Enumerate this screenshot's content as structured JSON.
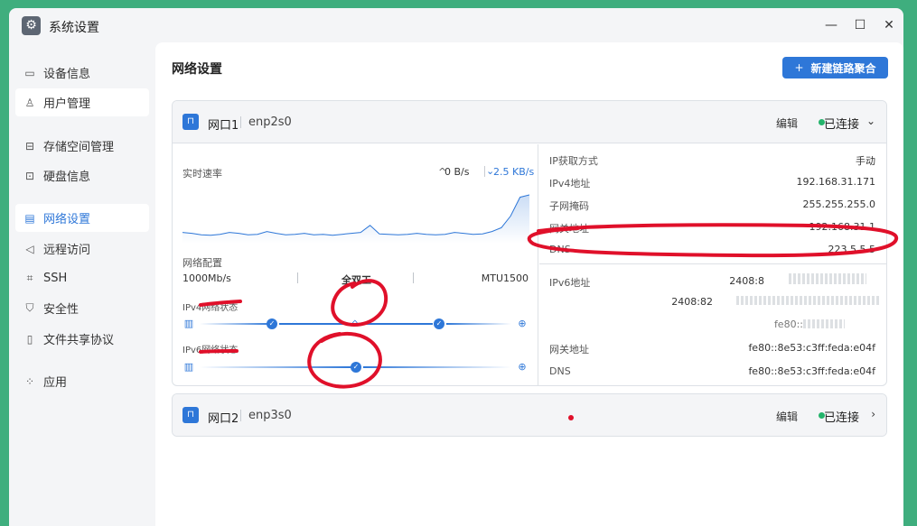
{
  "window": {
    "title": "系统设置",
    "icon": "gear-icon",
    "controls": {
      "minimize": "—",
      "maximize": "☐",
      "close": "✕"
    }
  },
  "sidebar": {
    "items": [
      {
        "label": "设备信息",
        "icon": "monitor-icon"
      },
      {
        "label": "用户管理",
        "icon": "user-icon"
      },
      {
        "label": "存储空间管理",
        "icon": "storage-icon"
      },
      {
        "label": "硬盘信息",
        "icon": "disk-icon"
      },
      {
        "label": "网络设置",
        "icon": "network-icon"
      },
      {
        "label": "远程访问",
        "icon": "send-icon"
      },
      {
        "label": "SSH",
        "icon": "code-icon"
      },
      {
        "label": "安全性",
        "icon": "shield-icon"
      },
      {
        "label": "文件共享协议",
        "icon": "file-icon"
      },
      {
        "label": "应用",
        "icon": "apps-icon"
      }
    ]
  },
  "main": {
    "title": "网络设置",
    "new_button": "新建链路聚合",
    "new_button_icon": "+"
  },
  "port1": {
    "name": "网口1",
    "device": "enp2s0",
    "edit": "编辑",
    "status": "已连接",
    "chevron": "⌄",
    "speed": {
      "label": "实时速率",
      "up": "0 B/s",
      "down": "2.5 KB/s",
      "up_arrow": "^",
      "down_arrow": "⌄",
      "chart_data": {
        "type": "area",
        "series": [
          {
            "values": [
              0.2,
              0.18,
              0.15,
              0.14,
              0.16,
              0.2,
              0.18,
              0.15,
              0.16,
              0.22,
              0.18,
              0.15,
              0.16,
              0.18,
              0.15,
              0.16,
              0.14,
              0.16,
              0.18,
              0.2,
              0.35,
              0.17,
              0.16,
              0.15,
              0.16,
              0.18,
              0.16,
              0.15,
              0.16,
              0.2,
              0.18,
              0.16,
              0.17,
              0.22,
              0.3,
              0.55,
              0.95,
              1.0
            ]
          }
        ]
      }
    },
    "config": {
      "label": "网络配置",
      "speed": "1000Mb/s",
      "duplex": "全双工",
      "mtu": "MTU1500"
    },
    "ipv4_status_label": "IPv4网络状态",
    "ipv6_status_label": "IPv6网络状态",
    "ipv4_info": [
      {
        "k": "IP获取方式",
        "v": "手动"
      },
      {
        "k": "IPv4地址",
        "v": "192.168.31.171"
      },
      {
        "k": "子网掩码",
        "v": "255.255.255.0"
      },
      {
        "k": "网关地址",
        "v": "192.168.31.1"
      },
      {
        "k": "DNS",
        "v": "223.5.5.5"
      }
    ],
    "ipv6_info": {
      "addr_label": "IPv6地址",
      "addr_line1": "2408:8",
      "addr_line2": "2408:82",
      "addr_line3": "fe80::",
      "gateway_label": "网关地址",
      "gateway": "fe80::8e53:c3ff:feda:e04f",
      "dns_label": "DNS",
      "dns": "fe80::8e53:c3ff:feda:e04f"
    }
  },
  "port2": {
    "name": "网口2",
    "device": "enp3s0",
    "edit": "编辑",
    "status": "已连接",
    "chevron": "›"
  },
  "colors": {
    "accent": "#2e77d8",
    "status_ok": "#23b46b",
    "annotation": "#e0102a",
    "desktop": "#3fae7e"
  }
}
